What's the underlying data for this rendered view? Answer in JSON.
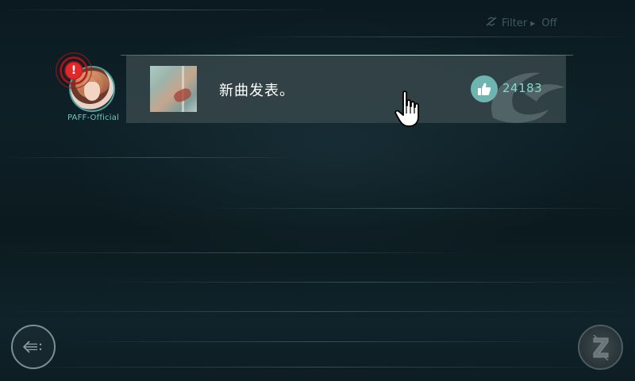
{
  "filter": {
    "label": "Filter",
    "value": "Off"
  },
  "post": {
    "author": "PAFF-Official",
    "text": "新曲发表。",
    "likes": "24183",
    "has_alert": true
  },
  "icons": {
    "filter": "filter-icon",
    "like": "thumbs-up-icon",
    "back": "back-arrow-icon",
    "menu": "logo-menu-icon",
    "alert": "alert-icon"
  },
  "colors": {
    "accent": "#6eb5b1",
    "like_count": "#7fd8cf",
    "author_name": "#6fc6bf",
    "alert": "#e1282b"
  }
}
